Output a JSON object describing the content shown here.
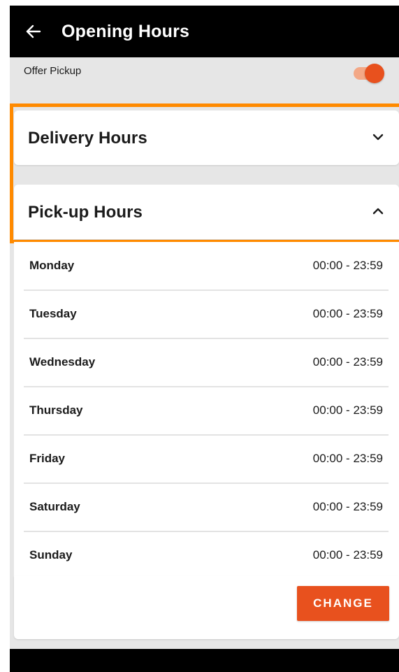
{
  "appbar": {
    "title": "Opening Hours",
    "back_icon": "arrow-left-icon"
  },
  "pickup_toggle": {
    "label": "Offer Pickup",
    "enabled": true
  },
  "sections": {
    "delivery": {
      "title": "Delivery Hours",
      "expanded": false,
      "icon": "chevron-down-icon"
    },
    "pickup": {
      "title": "Pick-up Hours",
      "expanded": true,
      "icon": "chevron-up-icon"
    }
  },
  "hours": [
    {
      "day": "Monday",
      "time": "00:00 - 23:59"
    },
    {
      "day": "Tuesday",
      "time": "00:00 - 23:59"
    },
    {
      "day": "Wednesday",
      "time": "00:00 - 23:59"
    },
    {
      "day": "Thursday",
      "time": "00:00 - 23:59"
    },
    {
      "day": "Friday",
      "time": "00:00 - 23:59"
    },
    {
      "day": "Saturday",
      "time": "00:00 - 23:59"
    },
    {
      "day": "Sunday",
      "time": "00:00 - 23:59"
    }
  ],
  "actions": {
    "change_label": "CHANGE"
  },
  "colors": {
    "accent": "#e8511e",
    "toggle_track": "#f3a886",
    "highlight": "#ff8a00",
    "appbar": "#000000",
    "background": "#e6e6e6"
  }
}
